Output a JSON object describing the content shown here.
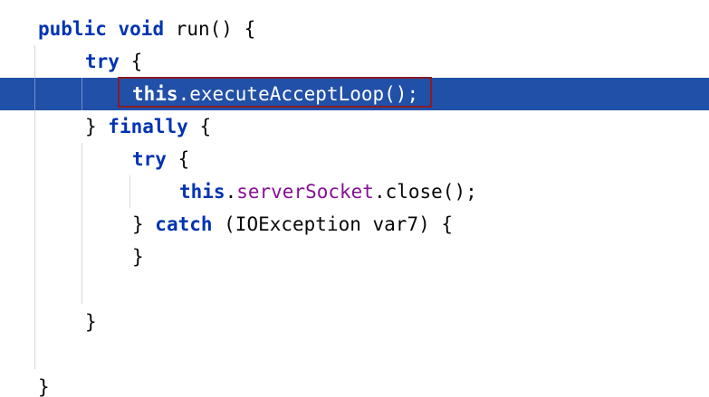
{
  "code": {
    "lines": [
      {
        "tokens": [
          {
            "t": "public",
            "k": "kw"
          },
          {
            "t": " "
          },
          {
            "t": "void",
            "k": "kw"
          },
          {
            "t": " run() {"
          }
        ]
      },
      {
        "tokens": [
          {
            "t": "try",
            "k": "kw"
          },
          {
            "t": " {"
          }
        ]
      },
      {
        "tokens": [
          {
            "t": "this",
            "k": "kw"
          },
          {
            "t": ".executeAcceptLoop();"
          }
        ]
      },
      {
        "tokens": [
          {
            "t": "} "
          },
          {
            "t": "finally",
            "k": "kw"
          },
          {
            "t": " {"
          }
        ]
      },
      {
        "tokens": [
          {
            "t": "try",
            "k": "kw"
          },
          {
            "t": " {"
          }
        ]
      },
      {
        "tokens": [
          {
            "t": "this",
            "k": "kw"
          },
          {
            "t": "."
          },
          {
            "t": "serverSocket",
            "k": "field"
          },
          {
            "t": ".close();"
          }
        ]
      },
      {
        "tokens": [
          {
            "t": "} "
          },
          {
            "t": "catch",
            "k": "kw"
          },
          {
            "t": " (IOException var7) {"
          }
        ]
      },
      {
        "tokens": [
          {
            "t": "}"
          }
        ]
      },
      {
        "tokens": []
      },
      {
        "tokens": [
          {
            "t": "}"
          }
        ]
      },
      {
        "tokens": []
      },
      {
        "tokens": [
          {
            "t": "}"
          }
        ]
      }
    ],
    "highlighted_line": 3,
    "boxed_text": "this.executeAcceptLoop();"
  },
  "colors": {
    "keyword": "#0033b3",
    "field": "#871094",
    "text": "#080808",
    "selection": "#2150a8",
    "box_border": "#8b1b24",
    "indent_guide": "#d6d6d6"
  }
}
